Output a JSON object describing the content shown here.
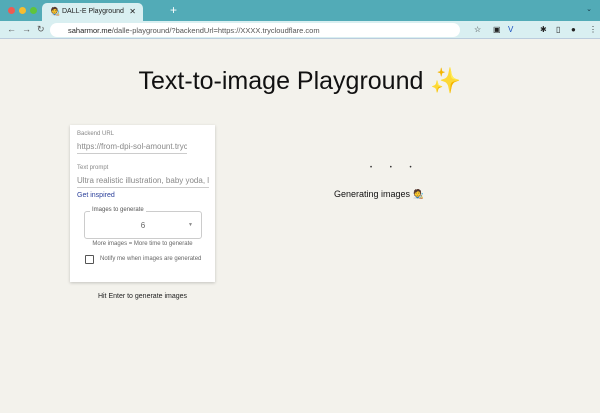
{
  "browser": {
    "tab_title": "DALL-E Playground",
    "tab_icon": "🧑‍🎨",
    "url_host": "saharmor.me",
    "url_path": "/dalle-playground/?backendUrl=https://XXXX.trycloudflare.com"
  },
  "page": {
    "title": "Text-to-image Playground ✨",
    "backend_label": "Backend URL",
    "backend_value": "https://from-dpi-sol-amount.tryc",
    "prompt_label": "Text prompt",
    "prompt_value": "Ultra realistic illustration, baby yoda, l",
    "inspired_link": "Get inspired",
    "images_label": "Images to generate",
    "images_value": "6",
    "images_help": "More images = More time to generate",
    "notify_label": "Notify me when images are generated",
    "notify_checked": false,
    "hint": "Hit Enter to generate images",
    "loading": "• • •",
    "status": "Generating images 🧑‍🎨"
  }
}
